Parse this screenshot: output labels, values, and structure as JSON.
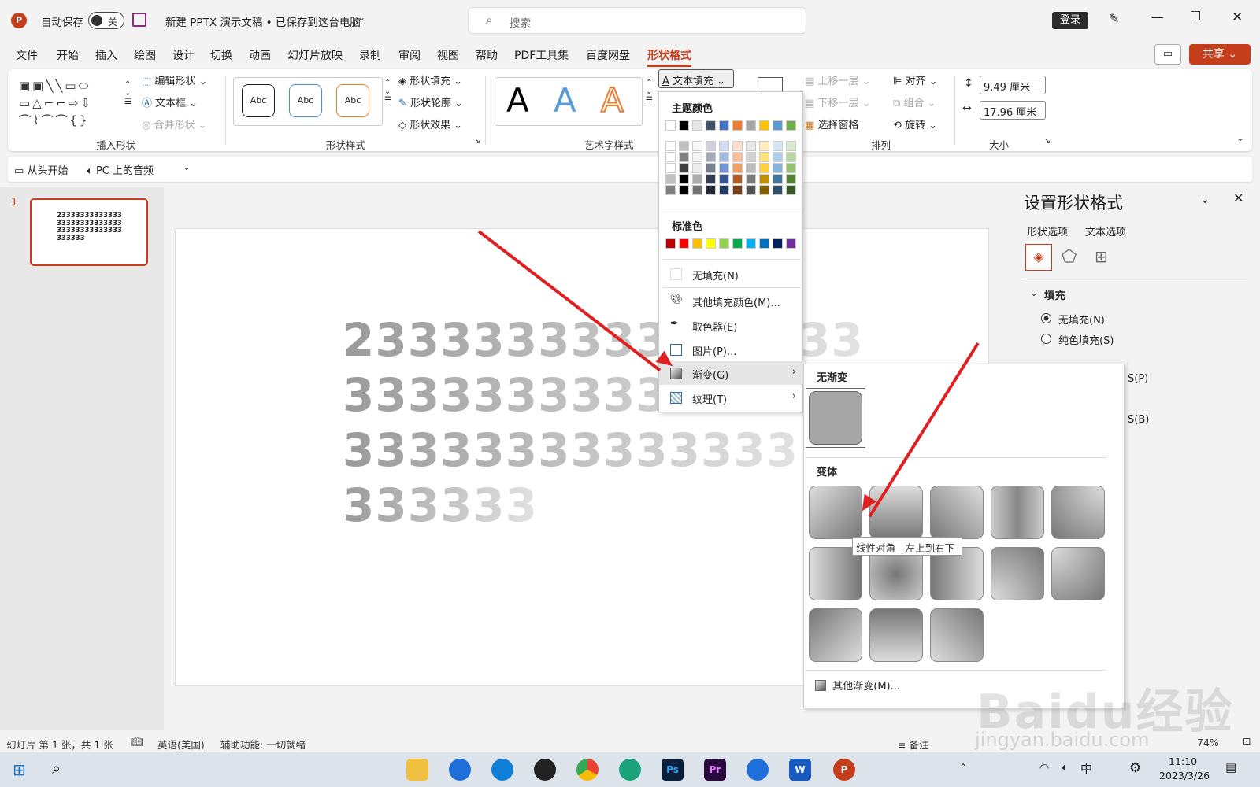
{
  "title_bar": {
    "logo": "P",
    "autosave_label": "自动保存",
    "autosave_state": "关",
    "doc_title": "新建 PPTX 演示文稿 • 已保存到这台电脑",
    "search_placeholder": "搜索",
    "login_label": "登录"
  },
  "menu": {
    "items": [
      "文件",
      "开始",
      "插入",
      "绘图",
      "设计",
      "切换",
      "动画",
      "幻灯片放映",
      "录制",
      "审阅",
      "视图",
      "帮助",
      "PDF工具集",
      "百度网盘",
      "形状格式"
    ],
    "active": "形状格式",
    "share_label": "共享"
  },
  "ribbon": {
    "insert_shapes": {
      "label": "插入形状",
      "edit_shape": "编辑形状",
      "text_box": "文本框",
      "merge_shapes": "合并形状"
    },
    "shape_styles": {
      "label": "形状样式",
      "samples": [
        "Abc",
        "Abc",
        "Abc"
      ],
      "fill": "形状填充",
      "outline": "形状轮廓",
      "effects": "形状效果"
    },
    "wordart": {
      "label": "艺术字样式",
      "samples": [
        "A",
        "A",
        "A"
      ],
      "text_fill": "文本填充"
    },
    "arrange": {
      "label": "排列",
      "bring_forward": "上移一层",
      "send_backward": "下移一层",
      "selection_pane": "选择窗格",
      "align": "对齐",
      "group": "组合",
      "rotate": "旋转"
    },
    "size": {
      "label": "大小",
      "height": "9.49 厘米",
      "width": "17.96 厘米"
    }
  },
  "quick_access": {
    "from_start": "从头开始",
    "audio": "PC 上的音频"
  },
  "slide_panel": {
    "number": "1",
    "thumb_lines": [
      "23333333333333",
      "33333333333333",
      "33333333333333",
      "333333"
    ]
  },
  "slide": {
    "lines": [
      "2333333333333333",
      "33333333333333",
      "33333333333333",
      "333333"
    ]
  },
  "format_pane": {
    "title": "设置形状格式",
    "tabs": [
      "形状选项",
      "文本选项"
    ],
    "section": "填充",
    "options": [
      "无填充(N)",
      "纯色填充(S)"
    ],
    "partial": [
      "S(P)",
      "S(B)"
    ]
  },
  "text_fill_menu": {
    "theme_colors_label": "主题颜色",
    "theme_colors": [
      "#ffffff",
      "#000000",
      "#e7e6e6",
      "#44546a",
      "#4472c4",
      "#ed7d31",
      "#a5a5a5",
      "#ffc000",
      "#5b9bd5",
      "#70ad47"
    ],
    "standard_colors_label": "标准色",
    "standard_colors": [
      "#c00000",
      "#ff0000",
      "#ffc000",
      "#ffff00",
      "#92d050",
      "#00b050",
      "#00b0f0",
      "#0070c0",
      "#002060",
      "#7030a0"
    ],
    "items": [
      "无填充(N)",
      "其他填充颜色(M)...",
      "取色器(E)",
      "图片(P)...",
      "渐变(G)",
      "纹理(T)"
    ]
  },
  "gradient_submenu": {
    "none_label": "无渐变",
    "variants_label": "变体",
    "more_label": "其他渐变(M)...",
    "tooltip": "线性对角 - 左上到右下"
  },
  "status_bar": {
    "slide_info": "幻灯片 第 1 张，共 1 张",
    "language": "英语(美国)",
    "accessibility": "辅助功能: 一切就绪",
    "notes": "备注",
    "zoom": "74%"
  },
  "taskbar": {
    "time": "11:10",
    "date": "2023/3/26",
    "ime": "中",
    "apps": [
      "Ps",
      "Pr",
      "W",
      "P"
    ]
  },
  "watermark": {
    "text": "Baidu经验",
    "url": "jingyan.baidu.com"
  }
}
